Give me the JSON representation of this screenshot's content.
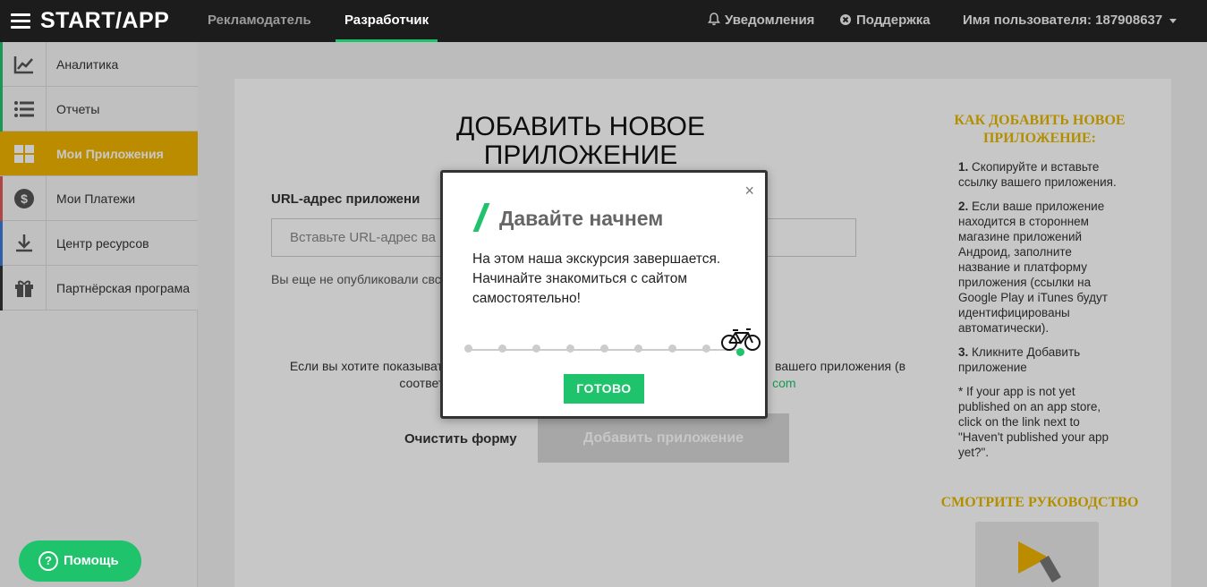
{
  "header": {
    "logo": "START/APP",
    "nav": [
      "Рекламодатель",
      "Разработчик"
    ],
    "active_nav": "Разработчик",
    "notifications": "Уведомления",
    "support": "Поддержка",
    "username": "Имя пользователя: 187908637"
  },
  "sidebar": {
    "items": [
      {
        "label": "Аналитика",
        "icon": "chart-icon",
        "accent": "#1ec36b"
      },
      {
        "label": "Отчеты",
        "icon": "list-icon",
        "accent": "#1ec36b"
      },
      {
        "label": "Мои Приложения",
        "icon": "grid-icon",
        "accent": "#f0b400",
        "active": true
      },
      {
        "label": "Мои Платежи",
        "icon": "dollar-icon",
        "accent": "#e05a5a"
      },
      {
        "label": "Центр ресурсов",
        "icon": "download-icon",
        "accent": "#3a7bd5"
      },
      {
        "label": "Партнёрская програма",
        "icon": "gift-icon",
        "accent": "#333333"
      }
    ]
  },
  "main": {
    "title": "ДОБАВИТЬ НОВОЕ ПРИЛОЖЕНИЕ",
    "url_label": "URL-адрес приложени",
    "url_placeholder": "Вставьте URL-адрес ва",
    "not_published": "Вы еще не опубликовали свс",
    "info_left": "Если вы хотите показывать ",
    "info_right": "вашего приложения (в",
    "info_line2_left": "соответс",
    "info_line2_right": "com",
    "clear_button": "Очистить форму",
    "add_button": "Добавить приложение"
  },
  "help": {
    "title": "КАК ДОБАВИТЬ НОВОЕ ПРИЛОЖЕНИЕ:",
    "step1_num": "1.",
    "step1": "Скопируйте и вставьте ссылку вашего приложения.",
    "step2_num": "2.",
    "step2": "Если ваше приложение находится в стороннем магазине приложений Андроид, заполните название и платформу приложения (ссылки на Google Play и iTunes будут идентифицированы автоматически).",
    "step3_num": "3.",
    "step3": "Кликните Добавить приложение",
    "note": "* If your app is not yet published on an app store, click on the link next to \"Haven't published your app yet?\".",
    "watch_title": "СМОТРИТЕ РУКОВОДСТВО"
  },
  "modal": {
    "title": "Давайте начнем",
    "body": "На этом наша экскурсия завершается. Начинайте знакомиться с сайтом самостоятельно!",
    "done_button": "ГОТОВО",
    "close": "×",
    "progress_steps": 9,
    "current_step": 9
  },
  "help_button": {
    "label": "Помощь"
  },
  "colors": {
    "accent_green": "#1ec36b",
    "accent_yellow": "#f0b400",
    "topbar": "#1c1c1c"
  }
}
